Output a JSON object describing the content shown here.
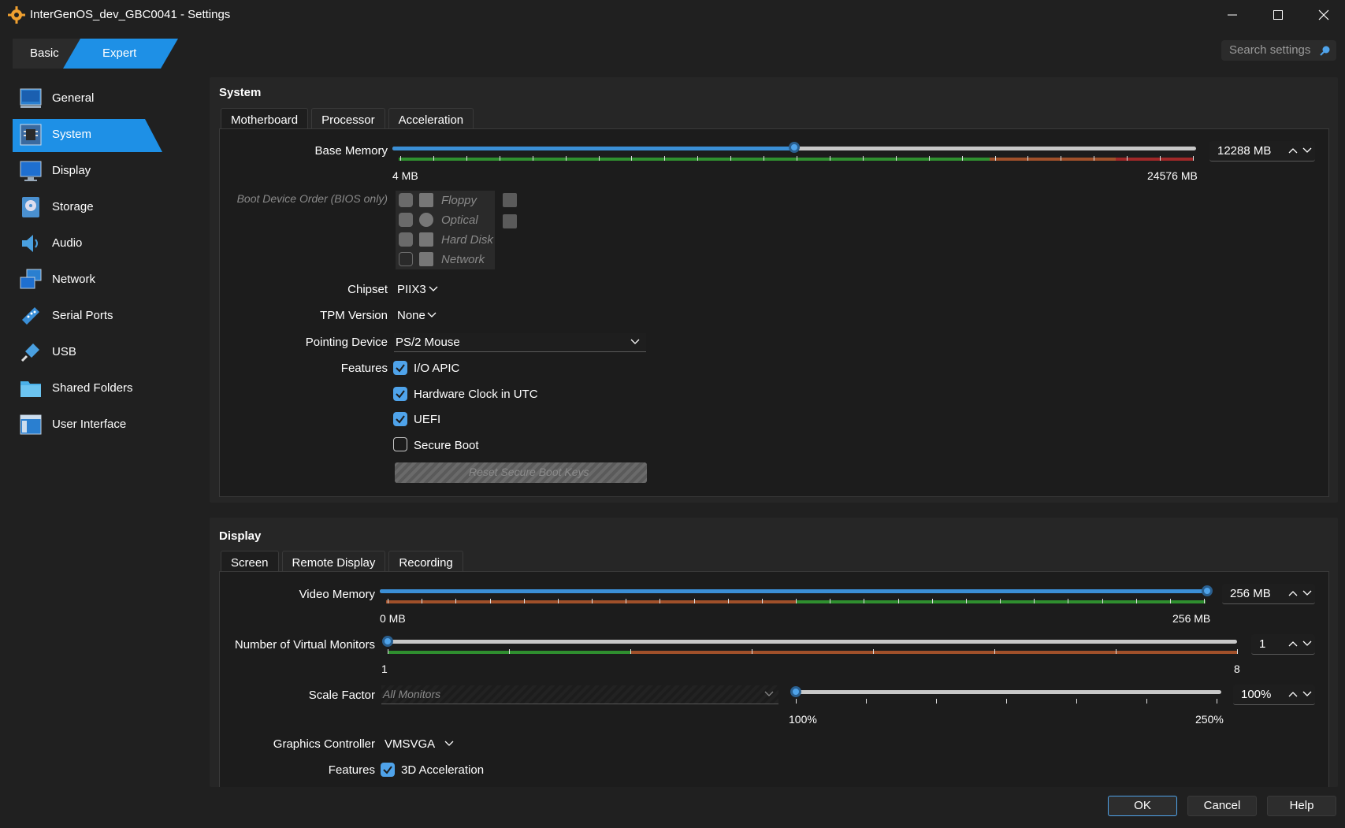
{
  "window": {
    "title": "InterGenOS_dev_GBC0041 - Settings"
  },
  "mode": {
    "basic": "Basic",
    "expert": "Expert"
  },
  "search": {
    "placeholder": "Search settings"
  },
  "sidebar": {
    "items": [
      {
        "label": "General",
        "icon": "general-icon"
      },
      {
        "label": "System",
        "icon": "system-icon",
        "active": true
      },
      {
        "label": "Display",
        "icon": "display-icon"
      },
      {
        "label": "Storage",
        "icon": "storage-icon"
      },
      {
        "label": "Audio",
        "icon": "audio-icon"
      },
      {
        "label": "Network",
        "icon": "network-icon"
      },
      {
        "label": "Serial Ports",
        "icon": "serial-ports-icon"
      },
      {
        "label": "USB",
        "icon": "usb-icon"
      },
      {
        "label": "Shared Folders",
        "icon": "shared-folders-icon"
      },
      {
        "label": "User Interface",
        "icon": "user-interface-icon"
      }
    ]
  },
  "system": {
    "title": "System",
    "tabs": [
      "Motherboard",
      "Processor",
      "Acceleration"
    ],
    "base_memory": {
      "label": "Base Memory",
      "value": "12288 MB",
      "min": "4 MB",
      "max": "24576 MB",
      "fraction": 0.5
    },
    "boot_order": {
      "label": "Boot Device Order (BIOS only)",
      "devices": [
        {
          "name": "Floppy",
          "checked": true
        },
        {
          "name": "Optical",
          "checked": true
        },
        {
          "name": "Hard Disk",
          "checked": true
        },
        {
          "name": "Network",
          "checked": false
        }
      ]
    },
    "chipset": {
      "label": "Chipset",
      "value": "PIIX3"
    },
    "tpm": {
      "label": "TPM Version",
      "value": "None"
    },
    "pointing": {
      "label": "Pointing Device",
      "value": "PS/2 Mouse"
    },
    "features": {
      "label": "Features",
      "io_apic": "I/O APIC",
      "hw_clock": "Hardware Clock in UTC",
      "uefi": "UEFI",
      "secure_boot": "Secure Boot",
      "reset_keys": "Reset Secure Boot Keys"
    }
  },
  "display": {
    "title": "Display",
    "tabs": [
      "Screen",
      "Remote Display",
      "Recording"
    ],
    "video_memory": {
      "label": "Video Memory",
      "value": "256 MB",
      "min": "0 MB",
      "max": "256 MB",
      "fraction": 1.0
    },
    "monitors": {
      "label": "Number of Virtual Monitors",
      "value": "1",
      "min": "1",
      "max": "8",
      "fraction": 0.0
    },
    "scale": {
      "label": "Scale Factor",
      "combo": "All Monitors",
      "value": "100%",
      "min": "100%",
      "max": "250%",
      "fraction": 0.0
    },
    "graphics": {
      "label": "Graphics Controller",
      "value": "VMSVGA"
    },
    "features": {
      "label": "Features",
      "accel3d": "3D Acceleration"
    }
  },
  "buttons": {
    "ok": "OK",
    "cancel": "Cancel",
    "help": "Help"
  },
  "colors": {
    "accent": "#1e90e6",
    "background": "#202020"
  }
}
